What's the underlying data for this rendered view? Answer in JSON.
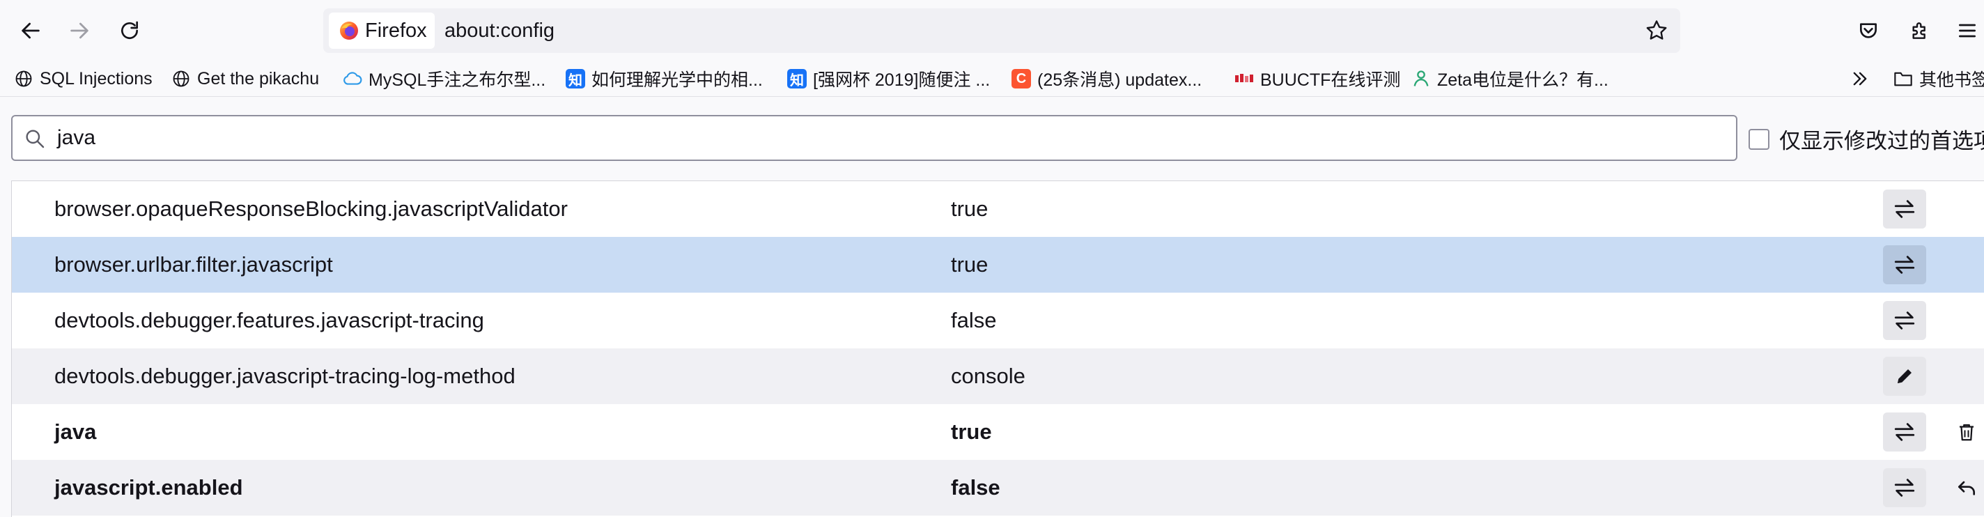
{
  "colors": {
    "toolbar_bg": "#f9f9fb",
    "urlbar_bg": "#f0f0f4",
    "selected_row": "#c9dcf4",
    "alt_row": "#f0f0f4",
    "icon": "#15141a"
  },
  "navbar": {
    "back_icon": "arrow-left-icon",
    "forward_icon": "arrow-right-icon",
    "reload_icon": "reload-icon",
    "identity_label": "Firefox",
    "url": "about:config",
    "bookmark_star_icon": "star-icon",
    "right_icons": [
      "pocket-icon",
      "extensions-icon",
      "menu-icon"
    ]
  },
  "bookmarks": [
    {
      "label": "SQL Injections",
      "icon": "globe-icon"
    },
    {
      "label": "Get the pikachu",
      "icon": "globe-icon"
    },
    {
      "label": "MySQL手注之布尔型...",
      "icon": "cloud-icon"
    },
    {
      "label": "如何理解光学中的相...",
      "icon": "zhihu-icon",
      "badge": "知"
    },
    {
      "label": "[强网杯 2019]随便注 ...",
      "icon": "zhihu-icon",
      "badge": "知"
    },
    {
      "label": "(25条消息) updatex...",
      "icon": "csdn-icon",
      "badge": "C"
    },
    {
      "label": "BUUCTF在线评测",
      "icon": "buuctf-icon"
    },
    {
      "label": "Zeta电位是什么？有...",
      "icon": "zeta-icon"
    }
  ],
  "bookmarks_overflow_icon": "chevron-double-right-icon",
  "other_bookmarks": {
    "label": "其他书签",
    "icon": "folder-icon"
  },
  "search": {
    "value": "java",
    "icon": "search-icon"
  },
  "show_modified": {
    "label": "仅显示修改过的首选项",
    "checked": false
  },
  "prefs": [
    {
      "name": "browser.opaqueResponseBlocking.javascriptValidator",
      "value": "true",
      "modified": false,
      "action": "toggle",
      "extra": ""
    },
    {
      "name": "browser.urlbar.filter.javascript",
      "value": "true",
      "modified": false,
      "action": "toggle",
      "extra": "",
      "selected": true
    },
    {
      "name": "devtools.debugger.features.javascript-tracing",
      "value": "false",
      "modified": false,
      "action": "toggle",
      "extra": ""
    },
    {
      "name": "devtools.debugger.javascript-tracing-log-method",
      "value": "console",
      "modified": false,
      "action": "edit",
      "extra": ""
    },
    {
      "name": "java",
      "value": "true",
      "modified": true,
      "action": "toggle",
      "extra": "delete"
    },
    {
      "name": "javascript.enabled",
      "value": "false",
      "modified": true,
      "action": "toggle",
      "extra": "reset"
    }
  ]
}
